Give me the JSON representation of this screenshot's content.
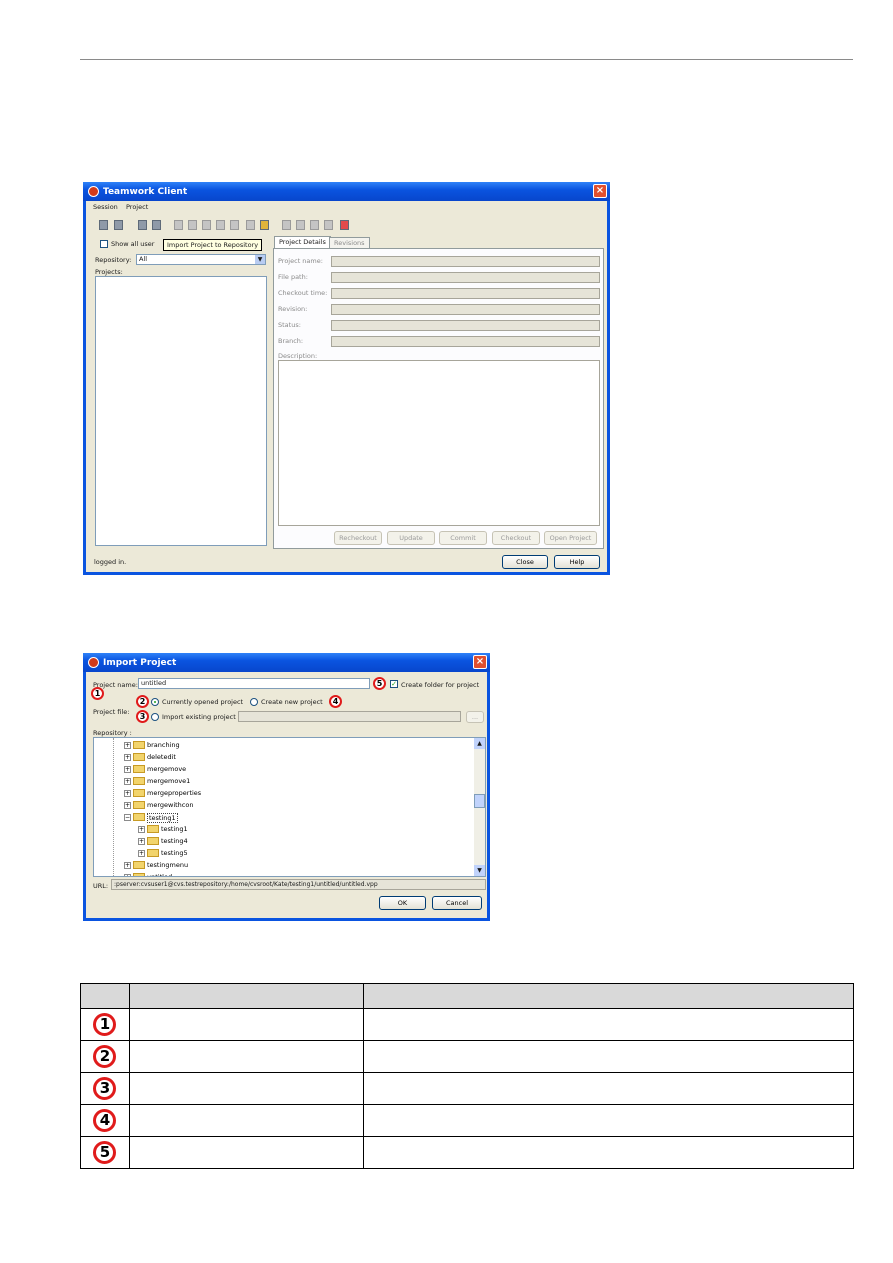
{
  "teamwork": {
    "title": "Teamwork Client",
    "menu": [
      "Session",
      "Project"
    ],
    "tooltip": "Import Project to Repository",
    "show_all_user": "Show all user",
    "repository_label": "Repository:",
    "repository_value": "All",
    "projects_label": "Projects:",
    "tabs": [
      "Project Details",
      "Revisions"
    ],
    "fields": [
      "Project name:",
      "File path:",
      "Checkout time:",
      "Revision:",
      "Status:",
      "Branch:"
    ],
    "description_label": "Description:",
    "action_buttons": [
      "Recheckout",
      "Update",
      "Commit",
      "Checkout",
      "Open Project"
    ],
    "status": "logged in.",
    "close_btn": "Close",
    "help_btn": "Help"
  },
  "import": {
    "title": "Import Project",
    "project_name_label": "Project name:",
    "project_name_value": "untitled",
    "create_folder": "Create folder for project",
    "project_file_label": "Project file:",
    "opt_current": "Currently opened project",
    "opt_new": "Create new project",
    "opt_existing": "Import existing project",
    "browse": "...",
    "repository_label": "Repository :",
    "tree": [
      "branching",
      "deletedit",
      "mergemove",
      "mergemove1",
      "mergeproperties",
      "mergewithcon",
      "testing1",
      "testing1",
      "testing4",
      "testing5",
      "testingmenu",
      "untitled"
    ],
    "url_label": "URL:",
    "url_value": ":pserver:cvsuser1@cvs.testrepository:/home/cvsroot/Kate/testing1/untitled/untitled.vpp",
    "ok": "OK",
    "cancel": "Cancel",
    "markers": [
      "1",
      "2",
      "3",
      "4",
      "5"
    ]
  },
  "table": {
    "rows": [
      "1",
      "2",
      "3",
      "4",
      "5"
    ]
  }
}
